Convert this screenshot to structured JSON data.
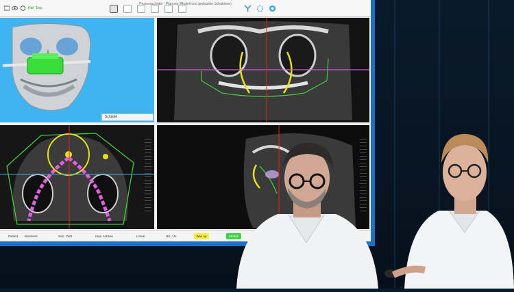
{
  "window": {
    "title": "Prozessschritte - Planung (Modell und gedruckte Schablone)"
  },
  "toolbar": {
    "left_labels": [
      "Hall",
      "Exp"
    ]
  },
  "viewport_3d": {
    "dropdown_label": "Schädel"
  },
  "workflow_steps": [
    {
      "label": "Patient",
      "state": "normal"
    },
    {
      "label": "Abutment",
      "state": "normal"
    },
    {
      "label": "Sulc. Zahl",
      "state": "normal"
    },
    {
      "label": "Impl. Achsen",
      "state": "normal"
    },
    {
      "label": "Lineal",
      "state": "normal"
    },
    {
      "label": "Bd. / Jv",
      "state": "normal"
    },
    {
      "label": "Wax up",
      "state": "done"
    },
    {
      "label": "Modell",
      "state": "active"
    }
  ],
  "colors": {
    "monitor_frame": "#1f6fc9",
    "viewport_3d_bg": "#40b4f0",
    "guide_green": "#3ecf3e",
    "canal_yellow": "#e8e21a",
    "crosshair_red": "#e22",
    "crosshair_magenta": "#e24ee2",
    "chain_pink": "#e060e0",
    "step_done": "#f6ee3a",
    "step_active": "#3fd23f"
  },
  "icons": [
    "visibility-icon",
    "eye-icon",
    "camera-icon",
    "layout-icon",
    "tooth-icon",
    "implant-icon",
    "crosshair-icon",
    "rotate-icon",
    "globe-icon"
  ]
}
